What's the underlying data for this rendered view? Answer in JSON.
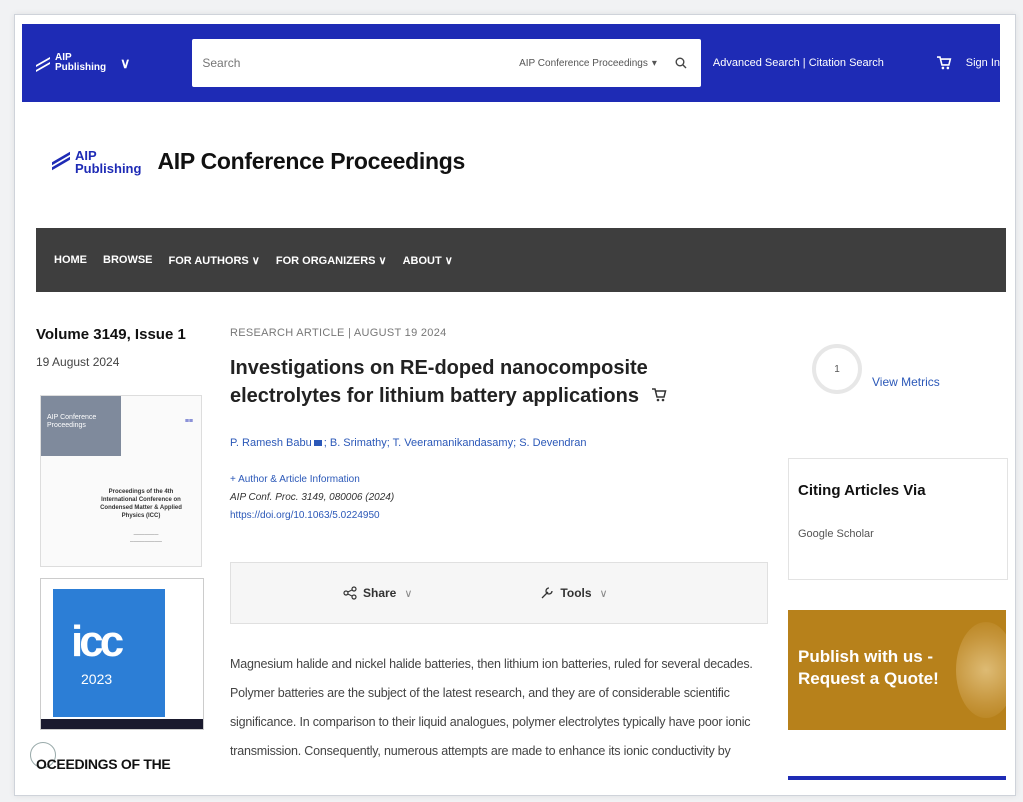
{
  "topbar": {
    "logo_line1": "AIP",
    "logo_line2": "Publishing",
    "search_placeholder": "Search",
    "search_scope": "AIP Conference Proceedings",
    "advanced_search": "Advanced Search | Citation Search",
    "sign_in": "Sign In"
  },
  "header": {
    "logo_line1": "AIP",
    "logo_line2": "Publishing",
    "journal_title": "AIP Conference Proceedings"
  },
  "nav": {
    "items": [
      "HOME",
      "BROWSE",
      "FOR AUTHORS ∨",
      "FOR ORGANIZERS ∨",
      "ABOUT ∨"
    ]
  },
  "issue": {
    "volume": "Volume 3149, Issue 1",
    "date": "19 August 2024",
    "cover1_band": "AIP Conference Proceedings",
    "cover1_text": "Proceedings of the 4th International Conference on Condensed Matter & Applied Physics (ICC)",
    "cover2_logo": "icc",
    "cover2_year": "2023",
    "caption": "OCEEDINGS OF THE"
  },
  "article": {
    "meta": "RESEARCH ARTICLE | AUGUST 19 2024",
    "title": "Investigations on RE-doped nanocomposite electrolytes for lithium battery applications",
    "authors_before_mail": "P. Ramesh Babu",
    "authors_after_mail": "; B. Srimathy; T. Veeramanikandasamy; S. Devendran",
    "author_info": "+ Author & Article Information",
    "citation": "AIP Conf. Proc. 3149, 080006 (2024)",
    "doi": "https://doi.org/10.1063/5.0224950",
    "share_label": "Share",
    "tools_label": "Tools",
    "abstract_lines": [
      "Magnesium halide and nickel halide batteries, then lithium ion batteries, ruled for several decades.",
      "Polymer batteries are the subject of the latest research, and they are of considerable scientific",
      "significance. In comparison to their liquid analogues, polymer electrolytes typically have poor ionic",
      "transmission. Consequently, numerous attempts are made to enhance its ionic conductivity by"
    ]
  },
  "sidebar": {
    "metric_value": "1",
    "view_metrics": "View Metrics",
    "citing_title": "Citing Articles Via",
    "google_scholar": "Google Scholar",
    "publish_line1": "Publish with us -",
    "publish_line2": "Request a Quote!"
  },
  "colors": {
    "topbar": "#1e2bb5",
    "navbar": "#3e3e3e",
    "link": "#2b58b8",
    "publish": "#b7811b"
  }
}
